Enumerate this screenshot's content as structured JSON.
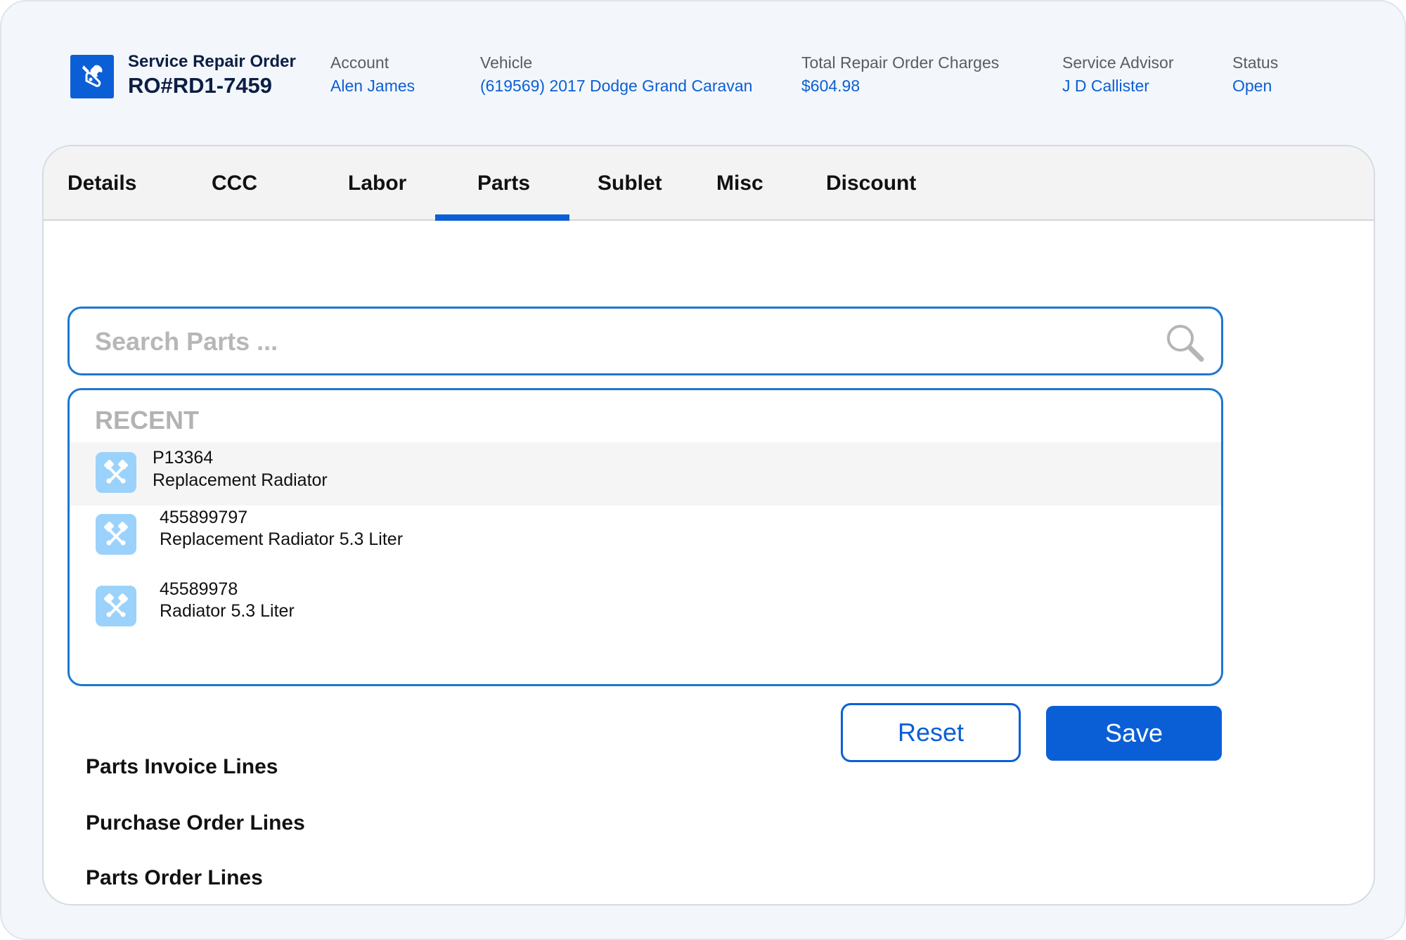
{
  "header": {
    "title": "Service Repair Order",
    "ro_number": "RO#RD1-7459",
    "fields": [
      {
        "label": "Account",
        "value": "Alen James"
      },
      {
        "label": "Vehicle",
        "value": "(619569) 2017 Dodge Grand Caravan"
      },
      {
        "label": "Total Repair Order Charges",
        "value": "$604.98"
      },
      {
        "label": "Service Advisor",
        "value": "J D Callister"
      },
      {
        "label": "Status",
        "value": "Open"
      }
    ]
  },
  "tabs": [
    {
      "label": "Details"
    },
    {
      "label": "CCC"
    },
    {
      "label": "Labor"
    },
    {
      "label": "Parts"
    },
    {
      "label": "Sublet"
    },
    {
      "label": "Misc"
    },
    {
      "label": "Discount"
    }
  ],
  "active_tab": "Parts",
  "search": {
    "placeholder": "Search Parts ...",
    "value": ""
  },
  "recent": {
    "heading": "RECENT",
    "items": [
      {
        "number": "P13364",
        "name": "Replacement Radiator"
      },
      {
        "number": "455899797",
        "name": "Replacement Radiator 5.3 Liter"
      },
      {
        "number": "45589978",
        "name": "Radiator 5.3 Liter"
      }
    ]
  },
  "buttons": {
    "reset": "Reset",
    "save": "Save"
  },
  "sections": [
    {
      "label": "Parts Invoice Lines"
    },
    {
      "label": "Purchase Order Lines"
    },
    {
      "label": "Parts Order Lines"
    }
  ],
  "colors": {
    "accent": "#0b5fd6",
    "border_blue": "#1b78d0",
    "icon_bg": "#9bd2fb",
    "placeholder": "#b7b7b7"
  },
  "icons": {
    "logo": "repair-wrench-icon",
    "search": "search-icon",
    "part": "pistons-icon"
  }
}
